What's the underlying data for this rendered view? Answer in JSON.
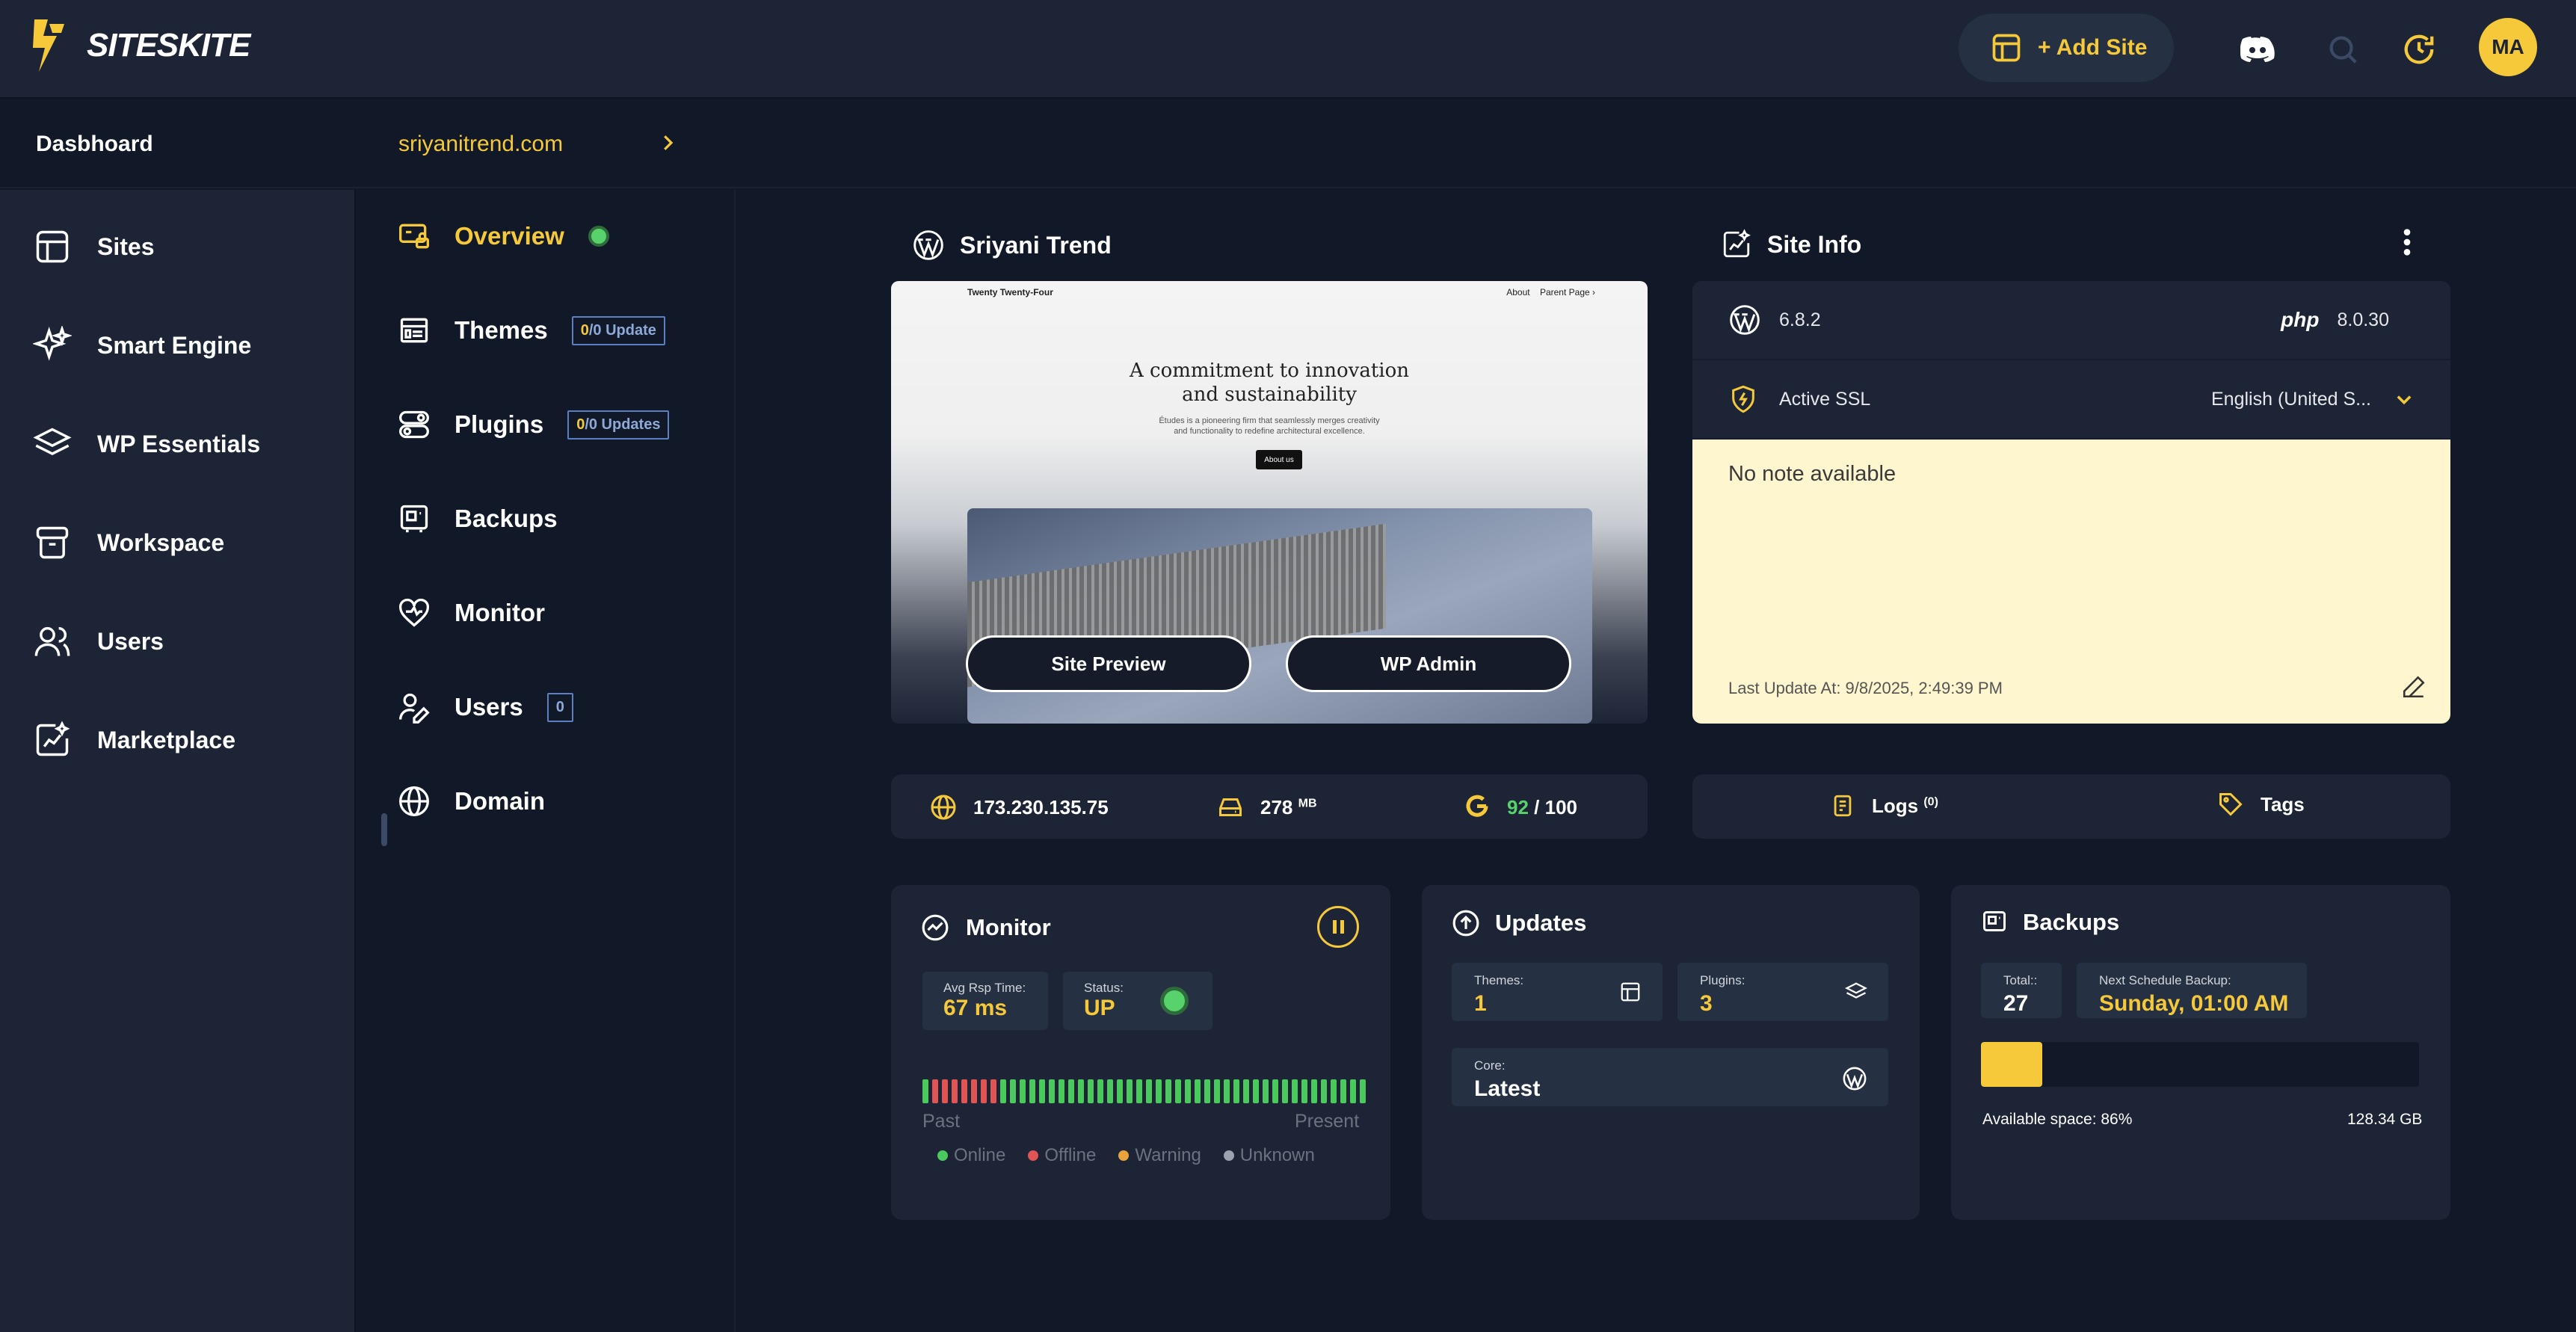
{
  "brand": {
    "name": "SITESKITE",
    "accent": "#f5c93a"
  },
  "topbar": {
    "add_site": "+ Add Site",
    "avatar": "MA",
    "icons": [
      "discord-icon",
      "search-icon",
      "history-icon"
    ]
  },
  "breadcrumb": {
    "dashboard": "Dasbhoard",
    "site": "sriyanitrend.com"
  },
  "sidebar": {
    "items": [
      {
        "label": "Sites",
        "icon": "layout-icon"
      },
      {
        "label": "Smart Engine",
        "icon": "sparkle-icon"
      },
      {
        "label": "WP Essentials",
        "icon": "layers-icon"
      },
      {
        "label": "Workspace",
        "icon": "archive-icon"
      },
      {
        "label": "Users",
        "icon": "users-icon"
      },
      {
        "label": "Marketplace",
        "icon": "marketplace-icon"
      }
    ]
  },
  "subnav": {
    "overview": "Overview",
    "themes": "Themes",
    "themes_badge_count": "0",
    "themes_badge_rest": "/0 Update",
    "plugins": "Plugins",
    "plugins_badge_count": "0",
    "plugins_badge_rest": "/0 Updates",
    "backups": "Backups",
    "monitor": "Monitor",
    "users": "Users",
    "users_badge": "0",
    "domain": "Domain"
  },
  "site": {
    "title": "Sriyani Trend",
    "preview": {
      "theme_name": "Twenty Twenty-Four",
      "nav_about": "About",
      "nav_parent": "Parent Page ›",
      "headline_1": "A commitment to innovation",
      "headline_2": "and sustainability",
      "body": "Études is a pioneering firm that seamlessly merges creativity and functionality to redefine architectural excellence.",
      "cta": "About us"
    },
    "site_preview": "Site Preview",
    "wp_admin": "WP Admin",
    "ip": "173.230.135.75",
    "storage": "278",
    "storage_unit": "MB",
    "score": "92",
    "score_max": "/ 100"
  },
  "site_info": {
    "title": "Site Info",
    "wp_version": "6.8.2",
    "php_label": "php",
    "php_version": "8.0.30",
    "ssl": "Active SSL",
    "language": "English (United S...",
    "note": "No note available",
    "last_update": "Last Update At: 9/8/2025, 2:49:39 PM",
    "logs": "Logs",
    "logs_count": "(0)",
    "tags": "Tags"
  },
  "monitor": {
    "title": "Monitor",
    "avg_label": "Avg Rsp Time:",
    "avg_value": "67 ms",
    "status_label": "Status:",
    "status_value": "UP",
    "past": "Past",
    "present": "Present",
    "legend": {
      "online": "Online",
      "offline": "Offline",
      "warning": "Warning",
      "unknown": "Unknown"
    },
    "colors": {
      "online": "#4ac95d",
      "offline": "#e05454",
      "warning": "#e8a33a",
      "unknown": "#9ca3af"
    },
    "history": [
      "online",
      "offline",
      "offline",
      "offline",
      "offline",
      "offline",
      "offline",
      "offline",
      "online",
      "online",
      "online",
      "online",
      "online",
      "online",
      "online",
      "online",
      "online",
      "online",
      "online",
      "online",
      "online",
      "online",
      "online",
      "online",
      "online",
      "online",
      "online",
      "online",
      "online",
      "online",
      "online",
      "online",
      "online",
      "online",
      "online",
      "online",
      "online",
      "online",
      "online",
      "online",
      "online",
      "online",
      "online",
      "online",
      "online",
      "online"
    ]
  },
  "updates": {
    "title": "Updates",
    "themes_label": "Themes:",
    "themes_value": "1",
    "plugins_label": "Plugins:",
    "plugins_value": "3",
    "core_label": "Core:",
    "core_value": "Latest"
  },
  "backups": {
    "title": "Backups",
    "total_label": "Total::",
    "total_value": "27",
    "next_label": "Next Schedule Backup:",
    "next_value": "Sunday, 01:00 AM",
    "used_fraction": 0.14,
    "available": "Available space: 86%",
    "size": "128.34 GB"
  }
}
